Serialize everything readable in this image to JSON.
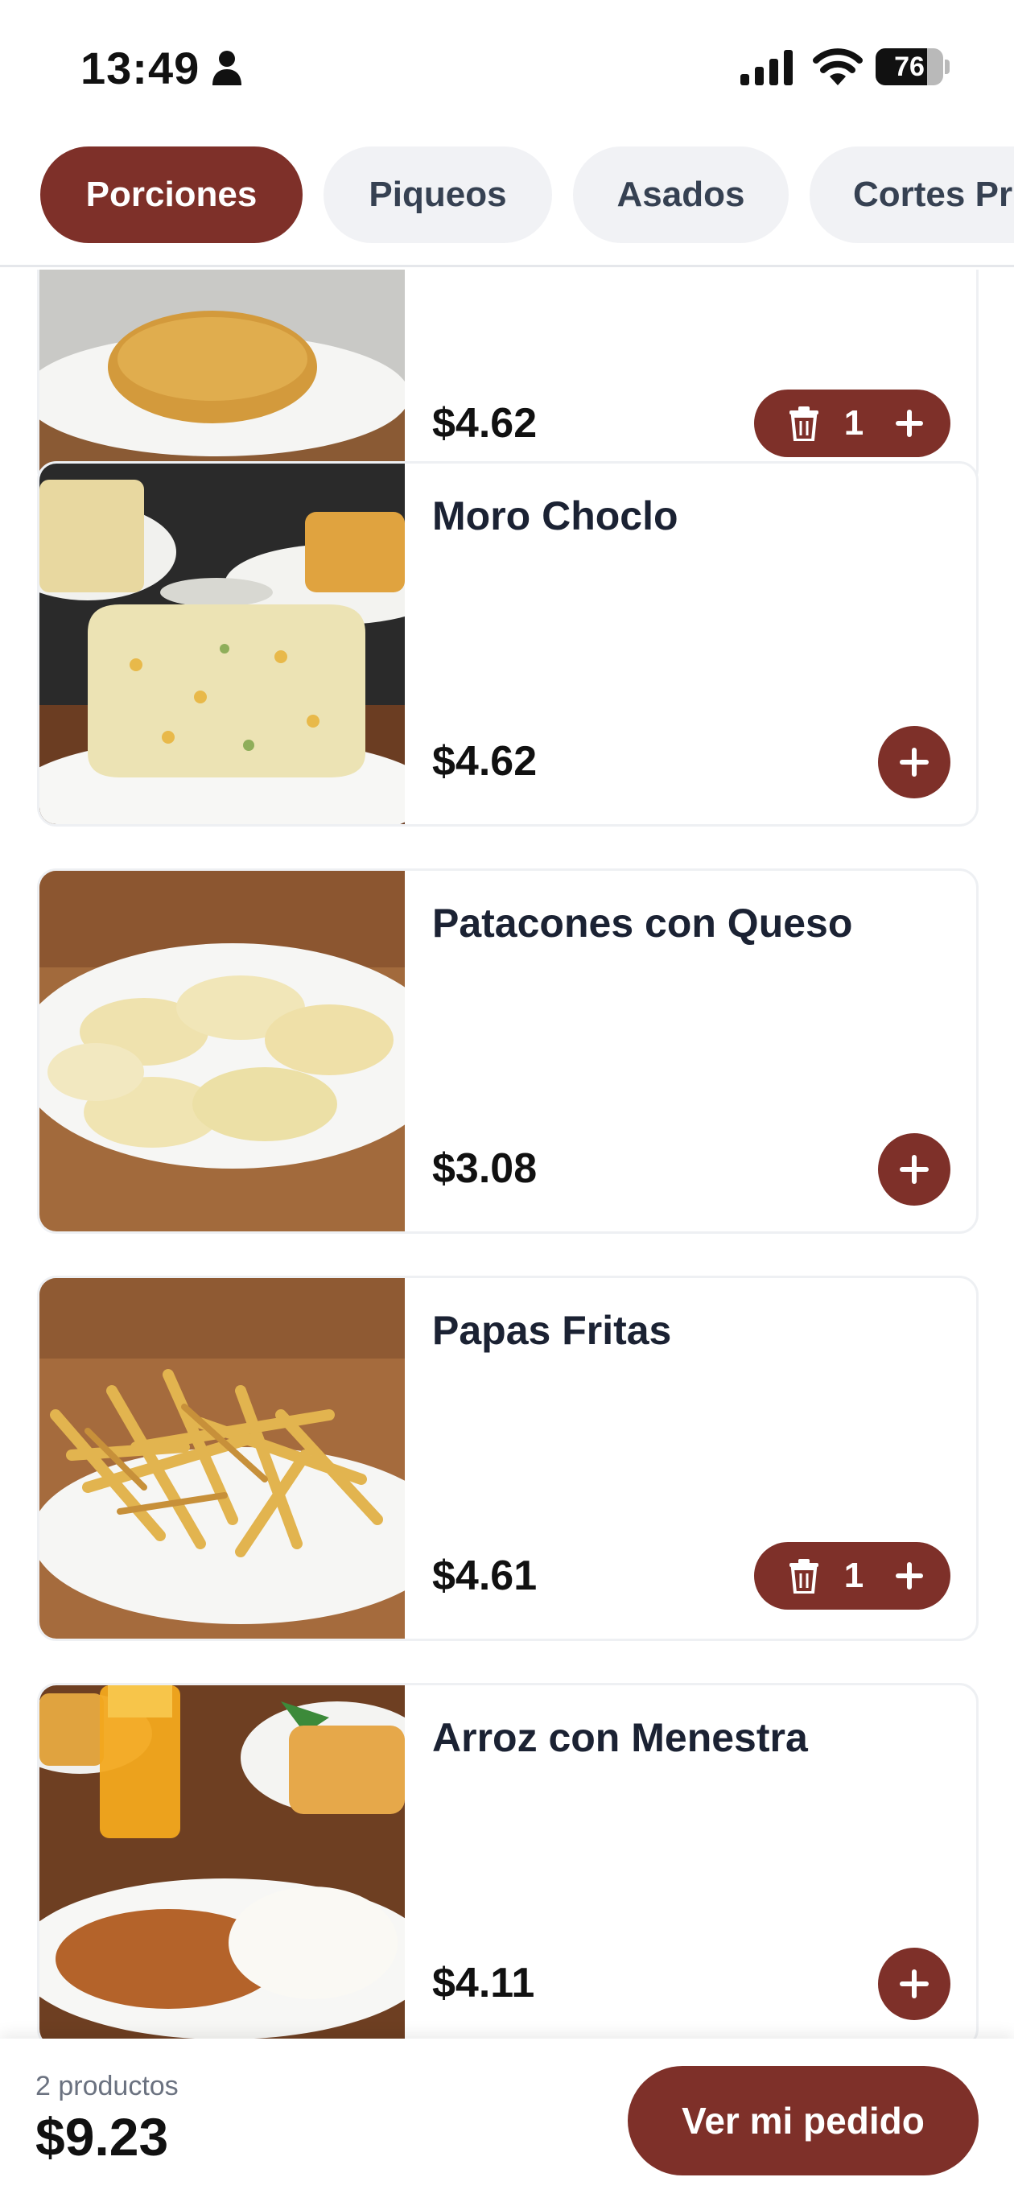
{
  "status_bar": {
    "time": "13:49",
    "battery_level": 76,
    "battery_label": "76"
  },
  "tabs": [
    {
      "label": "Porciones",
      "active": true
    },
    {
      "label": "Piqueos",
      "active": false
    },
    {
      "label": "Asados",
      "active": false
    },
    {
      "label": "Cortes Pr",
      "active": false
    }
  ],
  "products": [
    {
      "name": "",
      "price": "$4.62",
      "quantity": "1",
      "in_cart": true
    },
    {
      "name": "Moro Choclo",
      "price": "$4.62",
      "in_cart": false
    },
    {
      "name": "Patacones con Queso",
      "price": "$3.08",
      "in_cart": false
    },
    {
      "name": "Papas Fritas",
      "price": "$4.61",
      "quantity": "1",
      "in_cart": true
    },
    {
      "name": "Arroz con Menestra",
      "price": "$4.11",
      "in_cart": false
    }
  ],
  "footer": {
    "count_label": "2 productos",
    "total": "$9.23",
    "order_button": "Ver mi pedido"
  },
  "colors": {
    "accent": "#7e3029",
    "tab_inactive": "#f1f2f5",
    "text_dark": "#1b2233"
  },
  "icons": [
    "person-icon",
    "signal-icon",
    "wifi-icon",
    "battery-icon",
    "trash-icon",
    "plus-icon"
  ]
}
